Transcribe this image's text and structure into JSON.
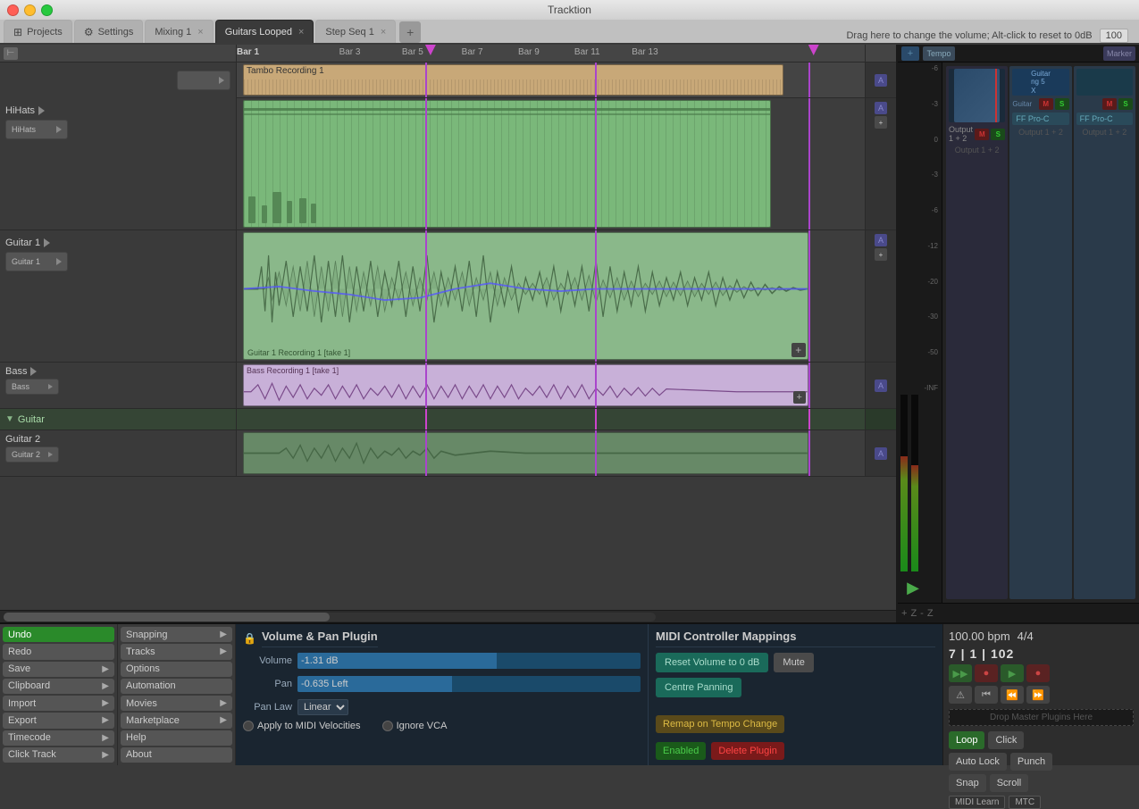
{
  "window": {
    "title": "Tracktion"
  },
  "titlebar": {
    "title": "Tracktion"
  },
  "tabs": {
    "items": [
      {
        "id": "projects",
        "label": "Projects",
        "icon": "grid",
        "active": false,
        "closable": false
      },
      {
        "id": "settings",
        "label": "Settings",
        "icon": "gear",
        "active": false,
        "closable": false
      },
      {
        "id": "mixing1",
        "label": "Mixing 1",
        "active": false,
        "closable": true
      },
      {
        "id": "guitars-looped",
        "label": "Guitars Looped",
        "active": true,
        "closable": true
      },
      {
        "id": "step-seq",
        "label": "Step Seq 1",
        "active": false,
        "closable": true
      }
    ],
    "add_label": "+",
    "volume_hint": "Drag here to change the volume; Alt-click to reset to 0dB",
    "volume_value": "100"
  },
  "tracks": [
    {
      "id": "tambo",
      "name": "",
      "height": "40",
      "clip": {
        "label": "Tambo Recording 1",
        "color": "#c8a878",
        "left_pct": 1,
        "width_pct": 85
      }
    },
    {
      "id": "hihats",
      "name": "HiHats",
      "height": "148",
      "clip": {
        "label": "",
        "color": "#7ab87a",
        "left_pct": 1,
        "width_pct": 85
      }
    },
    {
      "id": "guitar1",
      "name": "Guitar 1",
      "height": "148",
      "clip": {
        "label": "Guitar 1 Recording 1 [take 1]",
        "color": "#8ab88a",
        "left_pct": 1,
        "width_pct": 91
      }
    },
    {
      "id": "bass",
      "name": "Bass",
      "height": "52",
      "clip": {
        "label": "Bass Recording 1 [take 1]",
        "color": "#c8b0d8",
        "left_pct": 1,
        "width_pct": 91
      }
    },
    {
      "id": "guitar-group",
      "name": "Guitar",
      "height": "22",
      "is_group": true
    },
    {
      "id": "guitar2",
      "name": "Guitar 2",
      "height": "52",
      "clip": {
        "label": "",
        "color": "#8ab88a",
        "left_pct": 1,
        "width_pct": 91
      }
    }
  ],
  "ruler": {
    "marks": [
      {
        "label": "Bar 1",
        "pos": 0
      },
      {
        "label": "Bar 3",
        "pos": 17.5
      },
      {
        "label": "Bar 5",
        "pos": 27.5
      },
      {
        "label": "Bar 7",
        "pos": 36.8
      },
      {
        "label": "Bar 9",
        "pos": 46.2
      },
      {
        "label": "Bar 11",
        "pos": 55.5
      },
      {
        "label": "Bar 13",
        "pos": 64.9
      }
    ]
  },
  "playhead": {
    "position_pct": 30
  },
  "timeline_markers": [
    {
      "pos_pct": 30,
      "color": "#cc44cc"
    },
    {
      "pos_pct": 57,
      "color": "#cc44cc"
    },
    {
      "pos_pct": 91,
      "color": "#cc44cc"
    }
  ],
  "mixer": {
    "meter_labels": [
      "-6",
      "-3",
      "0",
      "-3",
      "-6",
      "-12",
      "-20",
      "-30",
      "-50",
      "-INF"
    ],
    "channels": [
      {
        "id": "ch1",
        "label": "Output 1 + 2",
        "m": "M",
        "s": "S",
        "plugins": [
          ""
        ],
        "output": "Output 1 + 2"
      },
      {
        "id": "ch2",
        "label": "Guitar\nng 5\nX",
        "m": "M",
        "s": "S",
        "plugins": [
          "FF Pro-C"
        ],
        "output": "Output 1 + 2"
      }
    ],
    "add_button": "+",
    "tempo_label": "Tempo",
    "marker_label": "Marker"
  },
  "plugin": {
    "title": "Volume & Pan Plugin",
    "volume_label": "Volume",
    "volume_value": "-1.31 dB",
    "volume_bar_pct": 58,
    "pan_label": "Pan",
    "pan_value": "-0.635 Left",
    "pan_bar_pct": 45,
    "pan_law_label": "Pan Law",
    "pan_law_value": "Linear",
    "checkbox1": "Apply to MIDI Velocities",
    "checkbox2": "Ignore VCA",
    "reset_volume_btn": "Reset Volume to 0 dB",
    "centre_panning_btn": "Centre Panning",
    "mute_btn": "Mute"
  },
  "midi": {
    "title": "MIDI Controller Mappings",
    "remap_btn": "Remap on Tempo Change",
    "enabled_btn": "Enabled",
    "delete_btn": "Delete Plugin"
  },
  "transport": {
    "bpm": "100.00 bpm",
    "time_sig": "4/4",
    "position": "7 | 1 | 102",
    "loop_btn": "Loop",
    "click_btn": "Click",
    "auto_lock_btn": "Auto Lock",
    "punch_btn": "Punch",
    "snap_btn": "Snap",
    "scroll_btn": "Scroll",
    "midi_learn_btn": "MIDI Learn",
    "mtc_btn": "MTC",
    "drop_master": "Drop Master Plugins Here",
    "z_label": "Z",
    "minus_label": "-",
    "plus_label": "+"
  },
  "bottom_left": {
    "undo": "Undo",
    "redo": "Redo",
    "save": "Save",
    "clipboard": "Clipboard",
    "import": "Import",
    "export": "Export",
    "timecode": "Timecode",
    "click_track": "Click Track",
    "snapping": "Snapping",
    "tracks": "Tracks",
    "options": "Options",
    "automation": "Automation",
    "movies": "Movies",
    "marketplace": "Marketplace",
    "help": "Help",
    "about": "About"
  },
  "icons": {
    "play": "▶",
    "stop": "■",
    "record": "●",
    "rewind": "⏮",
    "fast_forward": "⏭",
    "skip_back": "⏪",
    "skip_forward": "⏩",
    "loop": "↺",
    "arrow_right": "▶",
    "arrow_down": "▼",
    "plus": "+",
    "minus": "−",
    "close": "×",
    "gear": "⚙",
    "grid": "⊞",
    "lock": "🔒",
    "warning": "⚠"
  }
}
